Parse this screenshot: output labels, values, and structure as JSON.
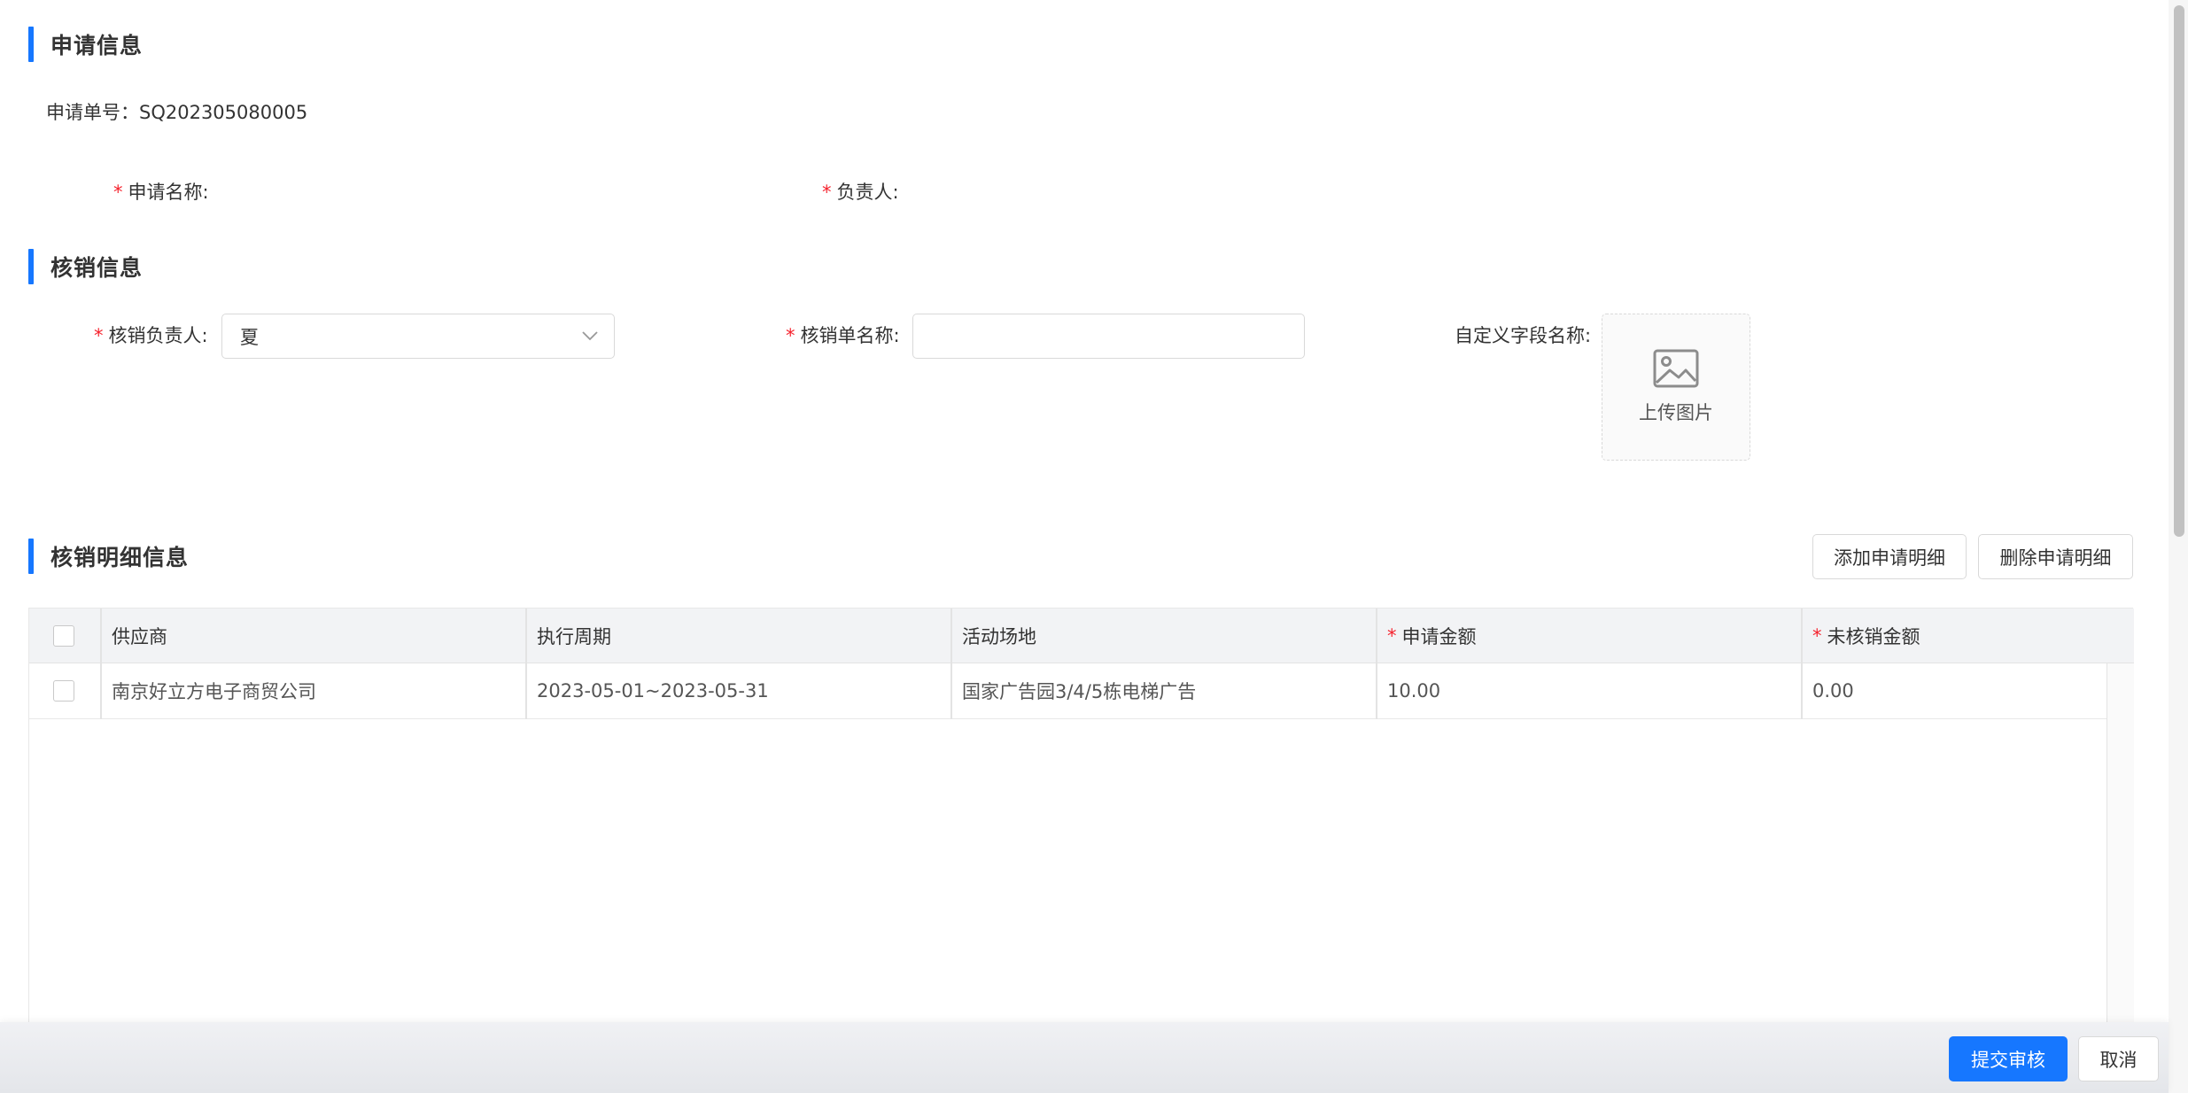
{
  "sections": {
    "apply_info": "申请信息",
    "writeoff_info": "核销信息",
    "detail_info": "核销明细信息"
  },
  "apply": {
    "number_label": "申请单号：",
    "number_value": "SQ202305080005",
    "name_label": "申请名称:",
    "owner_label": "负责人:"
  },
  "writeoff": {
    "owner_label": "核销负责人:",
    "owner_value": "夏",
    "doc_name_label": "核销单名称:",
    "doc_name_value": "",
    "custom_field_label": "自定义字段名称:",
    "upload_label": "上传图片"
  },
  "required_mark": "*",
  "detail_buttons": {
    "add": "添加申请明细",
    "delete": "删除申请明细"
  },
  "table": {
    "columns": [
      "供应商",
      "执行周期",
      "活动场地",
      "申请金额",
      "未核销金额"
    ],
    "required_columns": [
      false,
      false,
      false,
      true,
      true
    ],
    "rows": [
      {
        "supplier": "南京好立方电子商贸公司",
        "period": "2023-05-01~2023-05-31",
        "venue": "国家广告园3/4/5栋电梯广告",
        "apply_amount": "10.00",
        "unverified_amount": "0.00"
      }
    ]
  },
  "footer": {
    "submit": "提交审核",
    "cancel": "取消"
  },
  "colors": {
    "accent": "#1677ff",
    "required": "#f5222d"
  },
  "icons": {
    "select_arrow": "chevron-down-icon",
    "upload": "image-icon"
  }
}
